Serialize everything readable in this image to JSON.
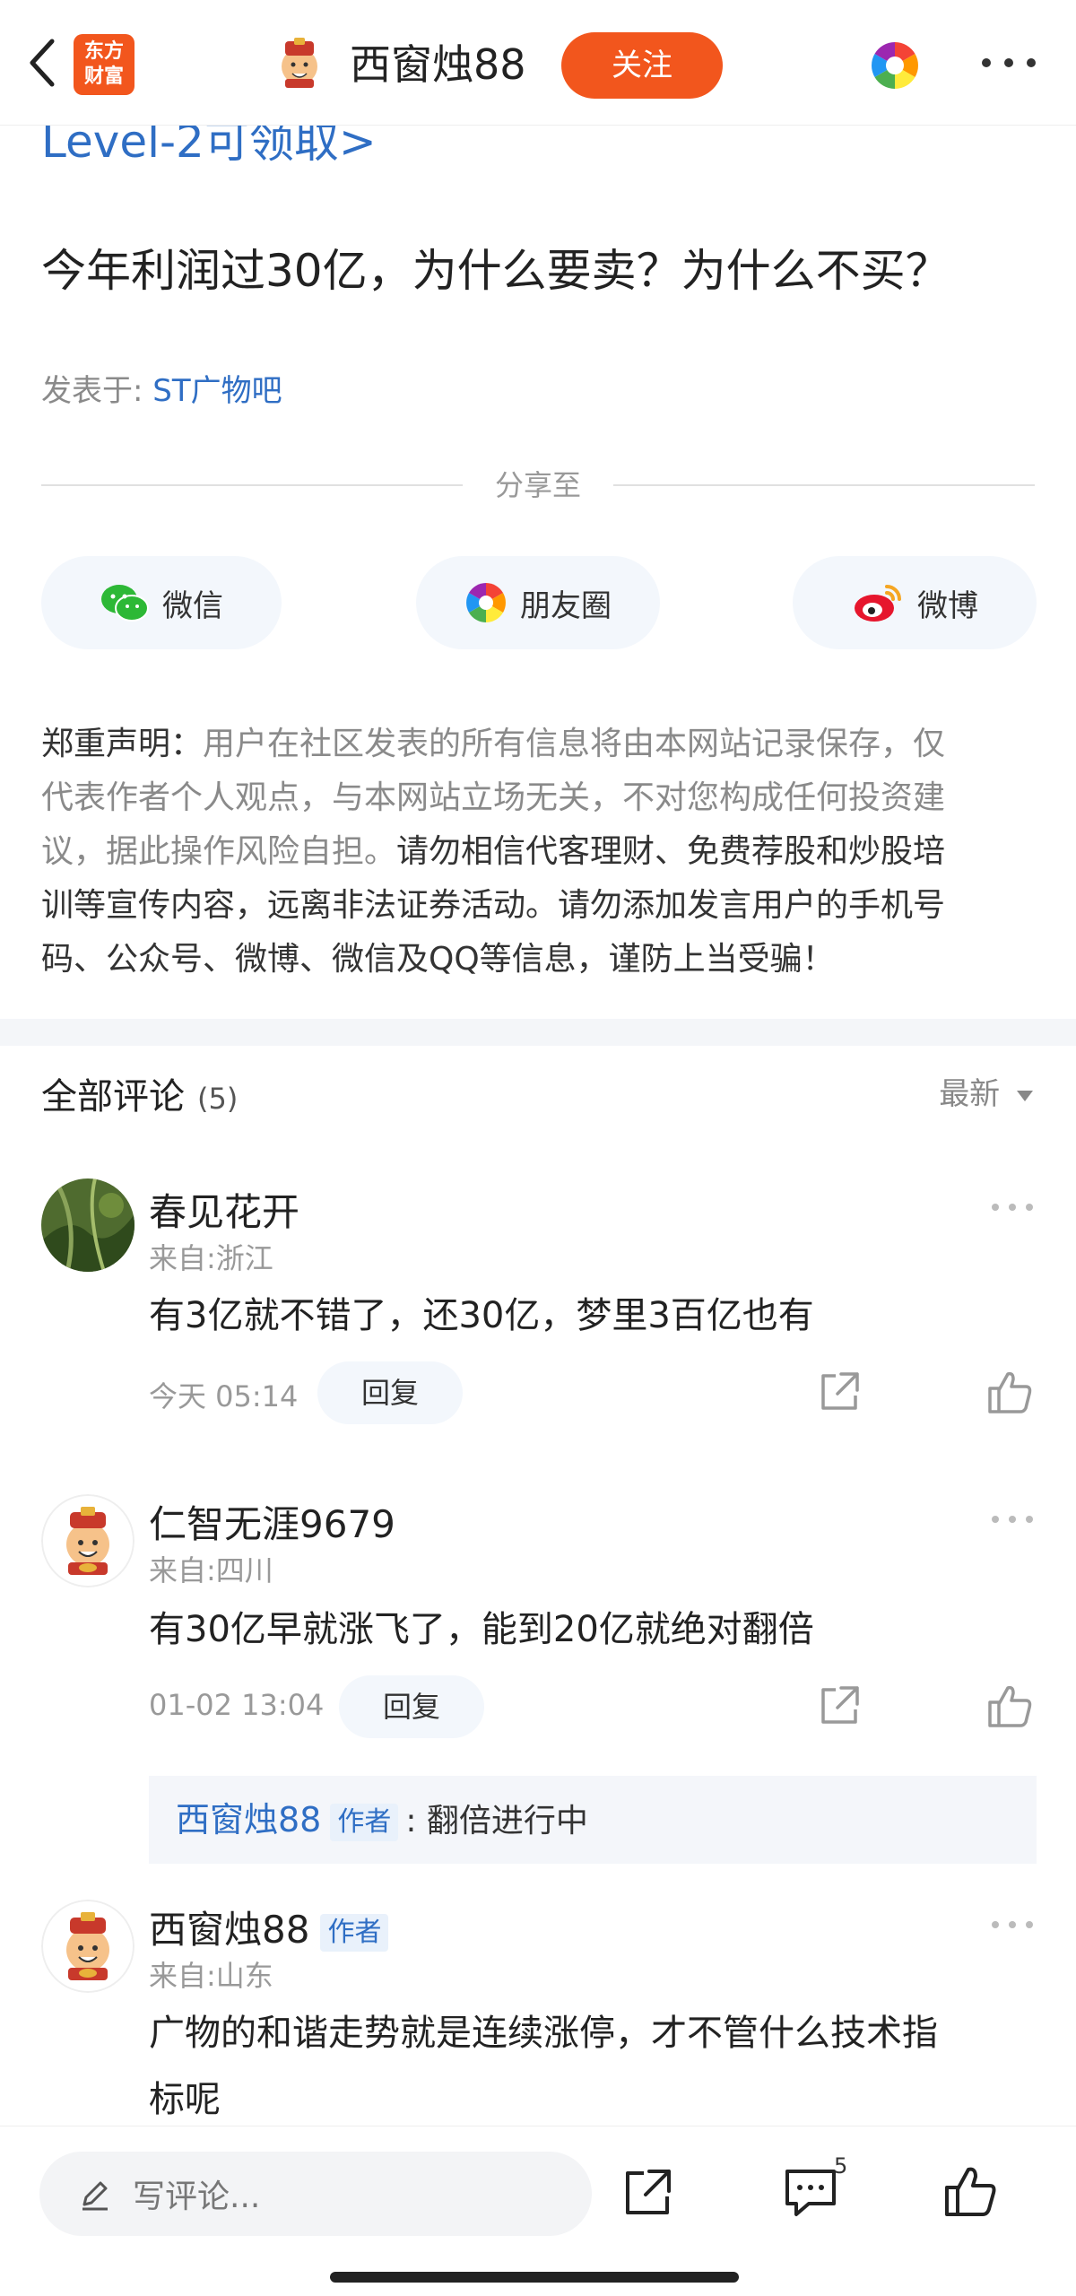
{
  "header": {
    "logo_line1": "东方",
    "logo_line2": "财富",
    "username": "西窗烛88",
    "follow_label": "关注"
  },
  "post": {
    "level2_link": "Level-2可领取>",
    "title": "今年利润过30亿，为什么要卖？为什么不买？",
    "posted_prefix": "发表于: ",
    "forum": "ST广物吧"
  },
  "share": {
    "label": "分享至",
    "wechat": "微信",
    "moments": "朋友圈",
    "weibo": "微博"
  },
  "disclaimer": {
    "line1_label": "郑重声明：",
    "line1_text": "用户在社区发表的所有信息将由本网站记录保存，仅",
    "line2": "代表作者个人观点，与本网站立场无关，不对您构成任何投资建",
    "line3_a": "议，据此操作风险自担。",
    "line3_b": "请勿相信代客理财、免费荐股和炒股培",
    "line4": "训等宣传内容，远离非法证券活动。请勿添加发言用户的手机号",
    "line5": "码、公众号、微博、微信及QQ等信息，谨防上当受骗！"
  },
  "comments_section": {
    "title": "全部评论",
    "count": "(5)",
    "sort_label": "最新"
  },
  "comments": [
    {
      "name": "春见花开",
      "from": "来自:浙江",
      "text": "有3亿就不错了，还30亿，梦里3百亿也有",
      "time": "今天 05:14",
      "reply_label": "回复"
    },
    {
      "name": "仁智无涯9679",
      "from": "来自:四川",
      "text": "有30亿早就涨飞了，能到20亿就绝对翻倍",
      "time": "01-02 13:04",
      "reply_label": "回复",
      "sub_reply": {
        "name": "西窗烛88",
        "tag": "作者",
        "text": ": 翻倍进行中"
      }
    },
    {
      "name": "西窗烛88",
      "tag": "作者",
      "from": "来自:山东",
      "text_line1": "广物的和谐走势就是连续涨停，才不管什么技术指",
      "text_line2": "标呢"
    }
  ],
  "bottom_bar": {
    "comment_placeholder": "写评论...",
    "comment_count_badge": "5"
  },
  "colors": {
    "brand_orange": "#f2561d",
    "link_blue": "#2f6ec4"
  }
}
